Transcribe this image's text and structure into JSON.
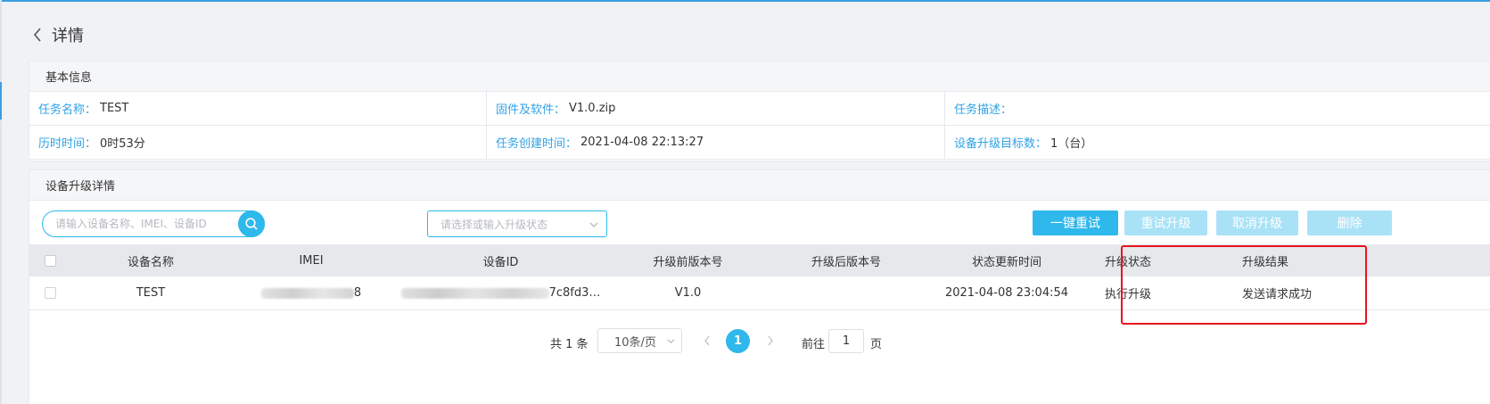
{
  "header": {
    "title": "详情"
  },
  "basic_info": {
    "title": "基本信息",
    "fields": [
      {
        "label": "任务名称：",
        "value": "TEST"
      },
      {
        "label": "固件及软件：",
        "value": "V1.0.zip"
      },
      {
        "label": "任务描述：",
        "value": ""
      },
      {
        "label": "历时时间：",
        "value": "0时53分"
      },
      {
        "label": "任务创建时间：",
        "value": "2021-04-08 22:13:27"
      },
      {
        "label": "设备升级目标数：",
        "value": "1（台）"
      }
    ]
  },
  "detail": {
    "title": "设备升级详情",
    "search_placeholder": "请输入设备名称、IMEI、设备ID",
    "status_placeholder": "请选择或输入升级状态",
    "buttons": {
      "retry_all": "一键重试",
      "retry_upgrade": "重试升级",
      "cancel_upgrade": "取消升级",
      "delete": "删除"
    },
    "columns": [
      "设备名称",
      "IMEI",
      "设备ID",
      "升级前版本号",
      "升级后版本号",
      "状态更新时间",
      "升级状态",
      "升级结果"
    ],
    "rows": [
      {
        "device_name": "TEST",
        "imei_visible": "8",
        "device_id_visible": "7c8fd3…",
        "prev_version": "V1.0",
        "next_version": "",
        "update_time": "2021-04-08 23:04:54",
        "status": "执行升级",
        "result": "发送请求成功"
      }
    ]
  },
  "pagination": {
    "total_text": "共 1 条",
    "page_size": "10条/页",
    "current_page": "1",
    "goto_label": "前往",
    "goto_value": "1",
    "goto_unit": "页"
  },
  "colors": {
    "accent": "#2fb8ec",
    "label_blue": "#2fa2e6",
    "highlight_red": "#e8131f",
    "disabled_button": "#a9e2f7"
  }
}
